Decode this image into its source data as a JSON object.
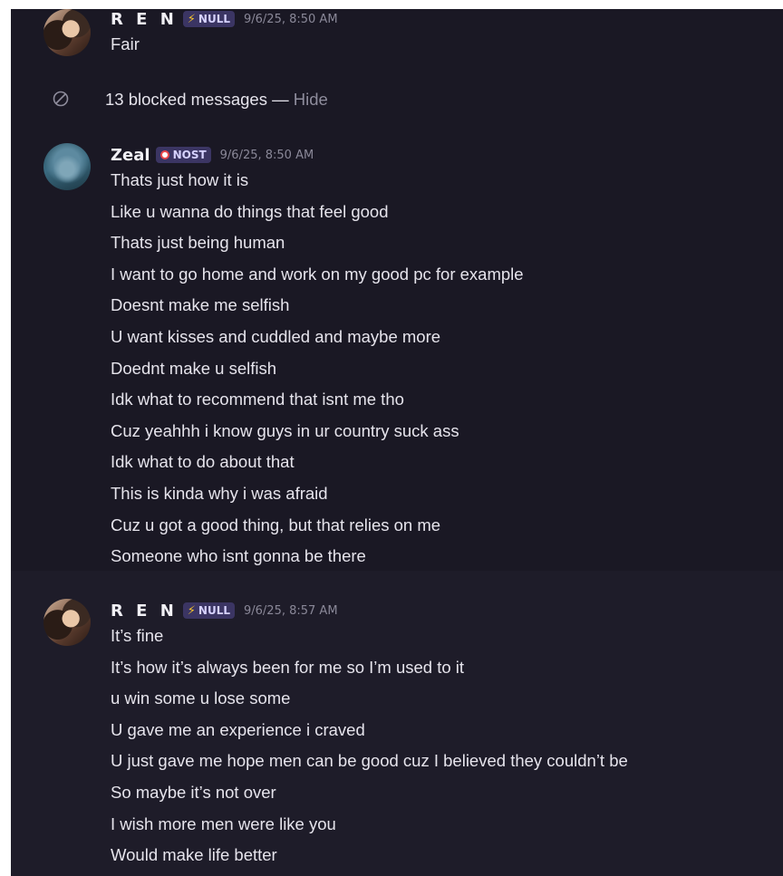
{
  "messages": [
    {
      "author": "R E N",
      "tag": "NULL",
      "tag_icon": "lightning-icon",
      "timestamp": "9/6/25, 8:50 AM",
      "lines": [
        "Fair"
      ]
    },
    {
      "author": "Zeal",
      "tag": "NOST",
      "tag_icon": "ring-icon",
      "timestamp": "9/6/25, 8:50 AM",
      "lines": [
        "Thats just how it is",
        "Like u wanna do things that feel good",
        "Thats just being human",
        "I want to go home and work on my good pc for example",
        "Doesnt make me selfish",
        "U want kisses and cuddled and maybe more",
        "Doednt make u selfish",
        "Idk what to recommend that isnt me tho",
        "Cuz yeahhh i know guys in ur country suck ass",
        "Idk what to do about that",
        "This is kinda why i was afraid",
        "Cuz u got a good thing, but that relies on me",
        "Someone who isnt gonna be there"
      ]
    },
    {
      "author": "R E N",
      "tag": "NULL",
      "tag_icon": "lightning-icon",
      "timestamp": "9/6/25, 8:57 AM",
      "lines": [
        "It’s fine",
        "It’s how it’s always been for me so I’m used to it",
        "u win some u lose some",
        "U gave me an experience i craved",
        "U just gave me hope men can be good cuz I believed they couldn’t be",
        "So maybe it’s not over",
        "I wish more men were like you",
        "Would make life better"
      ]
    }
  ],
  "blocked": {
    "text": "13 blocked messages — ",
    "hide_label": "Hide",
    "icon": "blocked-icon"
  },
  "colors": {
    "background": "#1a1824",
    "text": "#e6e4ec",
    "muted": "#8a8898",
    "tag_bg": "#3b3563",
    "lightning": "#f6c52b",
    "nost_ring": "#e8464b"
  }
}
